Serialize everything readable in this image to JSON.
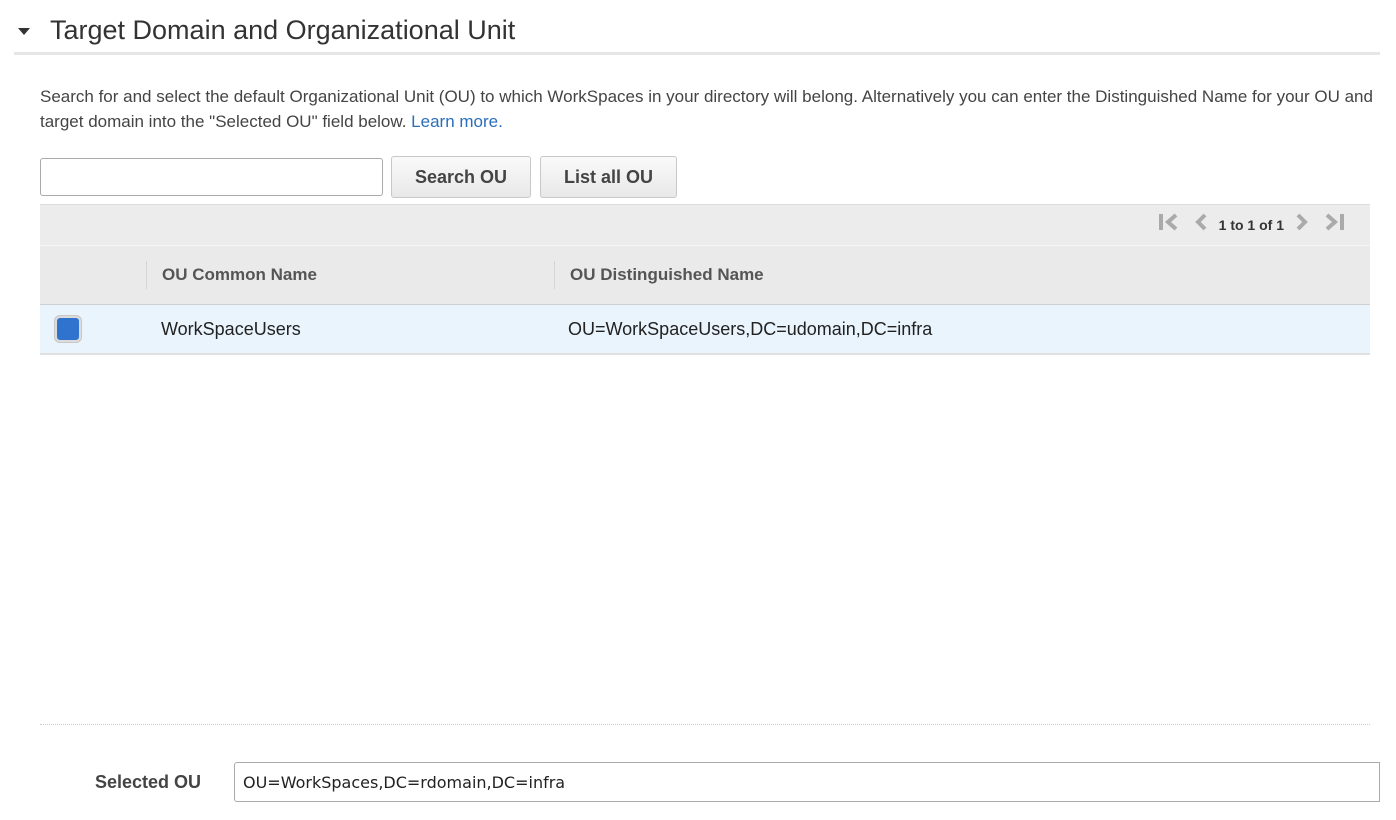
{
  "section": {
    "title": "Target Domain and Organizational Unit",
    "expanded": true
  },
  "description": {
    "text": "Search for and select the default Organizational Unit (OU) to which WorkSpaces in your directory will belong. Alternatively you can enter the Distinguished Name for your OU and target domain into the \"Selected OU\" field below. ",
    "link_label": "Learn more."
  },
  "search": {
    "value": "",
    "placeholder": "",
    "search_button": "Search OU",
    "list_button": "List all OU"
  },
  "pagination": {
    "first": "|<",
    "prev": "<",
    "label": "1 to 1 of 1",
    "next": ">",
    "last": ">|"
  },
  "table": {
    "columns": [
      "OU Common Name",
      "OU Distinguished Name"
    ],
    "rows": [
      {
        "selected": true,
        "common_name": "WorkSpaceUsers",
        "distinguished_name": "OU=WorkSpaceUsers,DC=udomain,DC=infra"
      }
    ]
  },
  "selected_ou": {
    "label": "Selected OU",
    "value": "OU=WorkSpaces,DC=rdomain,DC=infra"
  },
  "colors": {
    "link": "#2a6ebb",
    "selected_row": "#eaf4fd",
    "checkbox": "#2f73cf"
  }
}
